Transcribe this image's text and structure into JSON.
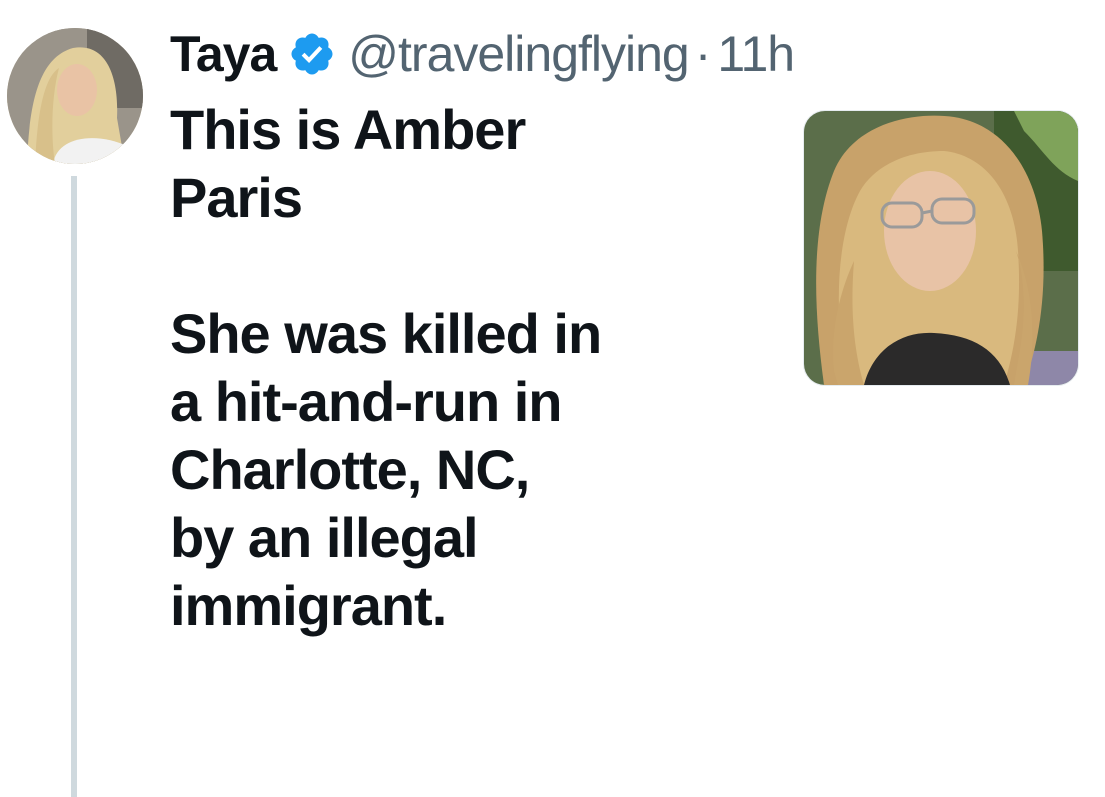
{
  "post": {
    "author": {
      "display_name": "Taya",
      "handle": "@travelingflying",
      "verified": true,
      "avatar_icon": "user-avatar-photo"
    },
    "separator": "·",
    "timestamp": "11h",
    "text_lines_p1": [
      "This is Amber",
      "Paris"
    ],
    "text_lines_p2": [
      "She was killed in",
      "a hit-and-run in",
      "Charlotte, NC,",
      "by an illegal",
      "immigrant."
    ],
    "media": {
      "type": "photo",
      "icon": "portrait-photo"
    }
  },
  "colors": {
    "text_primary": "#0f1419",
    "text_secondary": "#536471",
    "verified_blue": "#1d9bf0",
    "thread_line": "#cfd9de"
  }
}
